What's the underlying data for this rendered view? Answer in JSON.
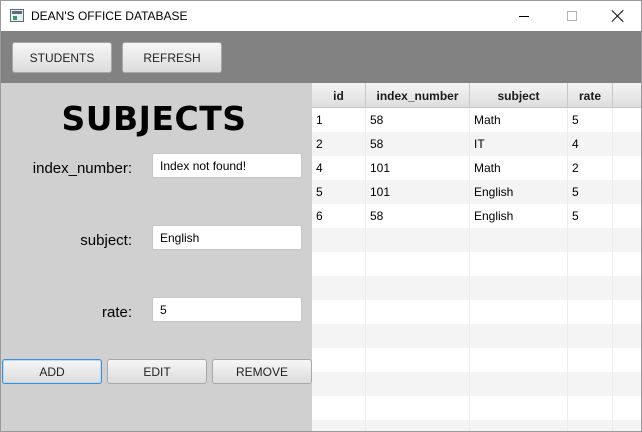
{
  "window": {
    "title": "DEAN'S OFFICE DATABASE"
  },
  "toolbar": {
    "students_label": "STUDENTS",
    "refresh_label": "REFRESH"
  },
  "form": {
    "heading": "SUBJECTS",
    "index_label": "index_number:",
    "index_value": "Index not found!",
    "subject_label": "subject:",
    "subject_value": "English",
    "rate_label": "rate:",
    "rate_value": "5",
    "add_label": "ADD",
    "edit_label": "EDIT",
    "remove_label": "REMOVE"
  },
  "table": {
    "columns": [
      "id",
      "index_number",
      "subject",
      "rate"
    ],
    "rows": [
      [
        "1",
        "58",
        "Math",
        "5"
      ],
      [
        "2",
        "58",
        "IT",
        "4"
      ],
      [
        "4",
        "101",
        "Math",
        "2"
      ],
      [
        "5",
        "101",
        "English",
        "5"
      ],
      [
        "6",
        "58",
        "English",
        "5"
      ]
    ]
  },
  "colors": {
    "toolbar_bg": "#828282",
    "panel_bg": "#d0d0d0",
    "focus_border": "#3a8fd8"
  }
}
